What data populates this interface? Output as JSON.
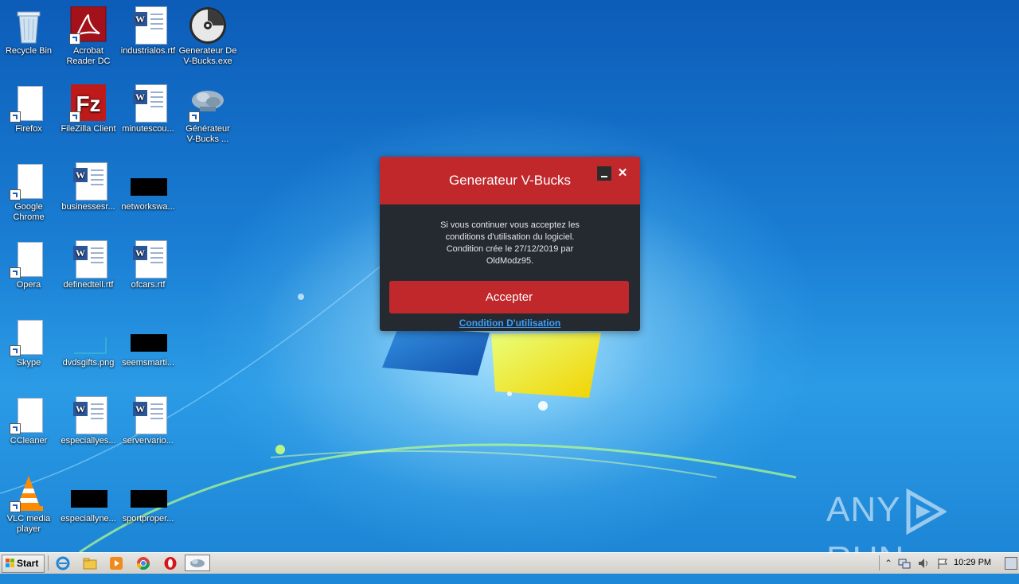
{
  "desktop": {
    "icons": [
      {
        "label": "Recycle Bin",
        "icon": "recycle-bin-icon"
      },
      {
        "label": "Acrobat\nReader DC",
        "icon": "acrobat-icon"
      },
      {
        "label": "industrialos.rtf",
        "icon": "word-doc-icon"
      },
      {
        "label": "Generateur De\nV-Bucks.exe",
        "icon": "disc-icon"
      },
      {
        "label": "Firefox",
        "icon": "blank-shortcut-icon"
      },
      {
        "label": "FileZilla Client",
        "icon": "filezilla-icon"
      },
      {
        "label": "minutescou...",
        "icon": "word-doc-icon"
      },
      {
        "label": "Générateur\nV-Bucks ...",
        "icon": "network-shortcut-icon"
      },
      {
        "label": "Google\nChrome",
        "icon": "blank-shortcut-icon"
      },
      {
        "label": "businessesr...",
        "icon": "word-doc-icon"
      },
      {
        "label": "networkswa...",
        "icon": "black-thumbnail-icon"
      },
      {
        "label": "Opera",
        "icon": "blank-shortcut-icon"
      },
      {
        "label": "definedtell.rtf",
        "icon": "word-doc-icon"
      },
      {
        "label": "ofcars.rtf",
        "icon": "word-doc-icon"
      },
      {
        "label": "Skype",
        "icon": "blank-shortcut-icon"
      },
      {
        "label": "dvdsgifts.png",
        "icon": "image-thumbnail-icon"
      },
      {
        "label": "seemsmarti...",
        "icon": "black-thumbnail-icon"
      },
      {
        "label": "CCleaner",
        "icon": "blank-shortcut-icon"
      },
      {
        "label": "especiallyes...",
        "icon": "word-doc-icon"
      },
      {
        "label": "servervario...",
        "icon": "word-doc-icon"
      },
      {
        "label": "VLC media\nplayer",
        "icon": "vlc-icon"
      },
      {
        "label": "especiallyne...",
        "icon": "black-thumbnail-icon"
      },
      {
        "label": "sportproper...",
        "icon": "black-thumbnail-icon"
      }
    ]
  },
  "dialog": {
    "title": "Generateur V-Bucks",
    "message": "Si vous continuer vous acceptez les\nconditions d'utilisation du logiciel.\nCondition crée le 27/12/2019 par\nOldModz95.",
    "accept_label": "Accepter",
    "terms_link": "Condition D'utilisation",
    "minimize_icon": "minimize-icon",
    "close_icon": "close-icon",
    "close_glyph": "✕",
    "header_color": "#c0282c",
    "body_color": "#252a30"
  },
  "watermark": {
    "left_text": "ANY",
    "right_text": "RUN"
  },
  "taskbar": {
    "start_label": "Start",
    "pinned": [
      "ie-icon",
      "explorer-icon",
      "media-player-icon",
      "chrome-icon",
      "opera-icon"
    ],
    "active_window_icon": "vbucks-app-icon",
    "tray_icons": [
      "show-hidden-icon",
      "network-icon",
      "volume-icon",
      "flag-icon"
    ],
    "clock": "10:29 PM"
  }
}
